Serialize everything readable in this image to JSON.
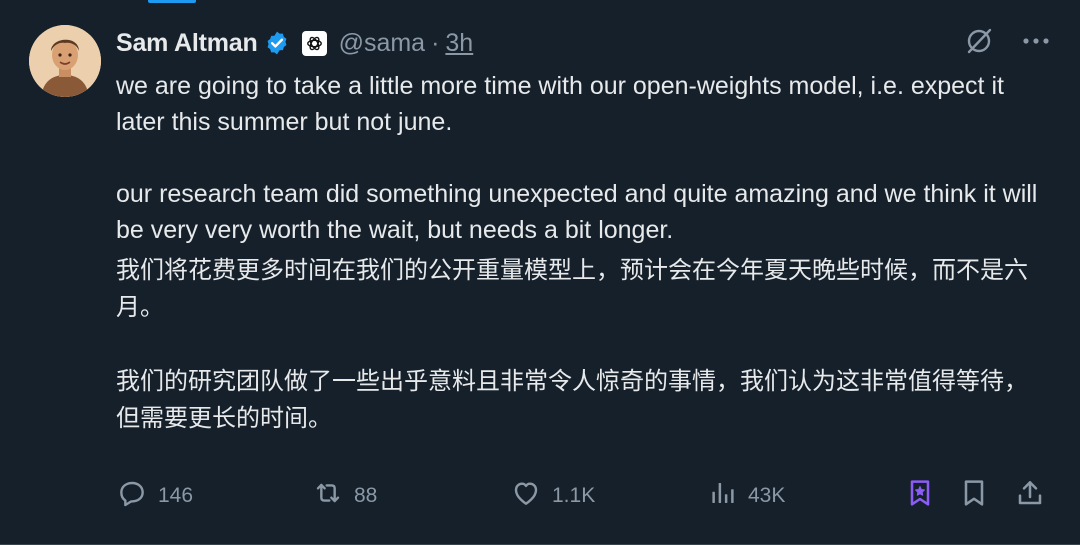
{
  "author": {
    "name": "Sam Altman",
    "handle": "@sama",
    "separator": "·",
    "time": "3h",
    "verified": true,
    "org_icon": "openai-logo-icon"
  },
  "tweet": {
    "en_paragraphs": [
      "we are going to take a little more time with our open-weights model, i.e. expect it later this summer but not june.",
      "our research team did something unexpected and quite amazing and we think it will be very very worth the wait, but needs a bit longer."
    ],
    "zh_paragraphs": [
      "我们将花费更多时间在我们的公开重量模型上，预计会在今年夏天晚些时候，而不是六月。",
      "我们的研究团队做了一些出乎意料且非常令人惊奇的事情，我们认为这非常值得等待，但需要更长的时间。"
    ]
  },
  "actions": {
    "replies": "146",
    "reposts": "88",
    "likes": "1.1K",
    "views": "43K"
  },
  "colors": {
    "background": "#15202b",
    "text": "#e7e9ea",
    "muted": "#8b98a5",
    "verified_blue": "#1d9bf0",
    "grok_purple": "#8b5cf6"
  }
}
